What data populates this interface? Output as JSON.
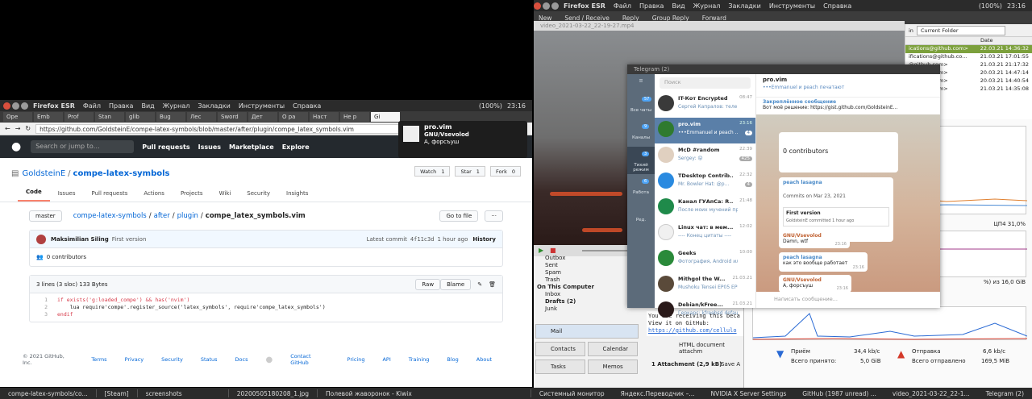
{
  "top_right_panel": {
    "app": "Firefox ESR",
    "menus": [
      "Файл",
      "Правка",
      "Вид",
      "Журнал",
      "Закладки",
      "Инструменты",
      "Справка"
    ],
    "tray_text": "(100%)",
    "time": "23:16"
  },
  "tb_toolbar": {
    "new": "New",
    "send_receive": "Send / Receive",
    "reply": "Reply",
    "group_reply": "Group Reply",
    "forward": "Forward"
  },
  "left_panel": {
    "app": "Firefox ESR",
    "menus": [
      "Файл",
      "Правка",
      "Вид",
      "Журнал",
      "Закладки",
      "Инструменты",
      "Справка"
    ],
    "battery": "(100%)",
    "time": "23:16",
    "tabs": [
      "Ope",
      "Emb",
      "Prof",
      "Stan",
      "glib",
      "Bug",
      "Лес",
      "Sword",
      "Дет",
      "O pa",
      "Hacт",
      "He p",
      "Gi"
    ],
    "url": "https://github.com/GoldsteinE/compe-latex-symbols/blob/master/after/plugin/compe_latex_symbols.vim"
  },
  "github": {
    "search_placeholder": "Search or jump to…",
    "nav": [
      "Pull requests",
      "Issues",
      "Marketplace",
      "Explore"
    ],
    "owner": "GoldsteinE",
    "repo": "compe-latex-symbols",
    "watch": "Watch",
    "watch_count": "1",
    "star": "Star",
    "star_count": "1",
    "fork": "Fork",
    "fork_count": "0",
    "tabs": [
      "Code",
      "Issues",
      "Pull requests",
      "Actions",
      "Projects",
      "Wiki",
      "Security",
      "Insights"
    ],
    "branch": "master",
    "path": [
      "compe-latex-symbols",
      "after",
      "plugin"
    ],
    "file": "compe_latex_symbols.vim",
    "go_to_file": "Go to file",
    "more": "···",
    "author": "Maksimilian Siling",
    "commit_msg": "First version",
    "latest_commit": "Latest commit",
    "commit_hash": "4f11c3d",
    "commit_time": "1 hour ago",
    "history": "History",
    "contributors": "0 contributors",
    "file_info": "3 lines (3 sloc)   133 Bytes",
    "raw": "Raw",
    "blame": "Blame",
    "code": [
      "if exists('g:loaded_compe') && has('nvim')",
      "    lua require'compe'.register_source('latex_symbols', require'compe_latex_symbols')",
      "endif"
    ],
    "footer": [
      "© 2021 GitHub, Inc.",
      "Terms",
      "Privacy",
      "Security",
      "Status",
      "Docs",
      "Contact GitHub",
      "Pricing",
      "API",
      "Training",
      "Blog",
      "About"
    ]
  },
  "notification": {
    "title": "pro.vim",
    "subtitle": "GNU/Vsevolod",
    "body": "А, форсъуш"
  },
  "video": {
    "title": "video_2021-03-22_22-19-27.mp4"
  },
  "mail_list": {
    "search_scope": "in",
    "folder": "Current Folder",
    "date_header": "Date",
    "rows": [
      {
        "from": "ications@github.com>",
        "date": "22.03.21 14:36:32"
      },
      {
        "from": "ifications@github.co...",
        "date": "21.03.21 17:01:55"
      },
      {
        "from": "@github.com>",
        "date": "21.03.21 21:17:32"
      },
      {
        "from": "@github.com>",
        "date": "20.03.21 14:47:14"
      },
      {
        "from": "@github.com>",
        "date": "20.03.21 14:40:54"
      },
      {
        "from": "@github.com>",
        "date": "21.03.21 14:35:08"
      }
    ]
  },
  "telegram": {
    "title": "Telegram (2)",
    "search": "Поиск",
    "folders": [
      {
        "label": "Все чаты",
        "badge": "57"
      },
      {
        "label": "Каналы",
        "badge": "9"
      },
      {
        "label": "Тихий режим",
        "badge": "3"
      },
      {
        "label": "Работа",
        "badge": "6"
      },
      {
        "label": "Ред.",
        "badge": ""
      }
    ],
    "chats": [
      {
        "name": "IT-Кот Encrypted",
        "preview": "Сергей Капралов: теле...",
        "time": "08:47",
        "count": ""
      },
      {
        "name": "pro.vim",
        "preview": "•••Emmanuel и peach ...",
        "time": "23:16",
        "count": "4"
      },
      {
        "name": "McD #random",
        "preview": "Sergey: 😝",
        "time": "22:39",
        "count": "425"
      },
      {
        "name": "TDesktop Contrib...",
        "preview": "Mr. Bowler Hat: @p...",
        "time": "22:32",
        "count": "4"
      },
      {
        "name": "Канал ГУАпСа: R...",
        "preview": "После моих мучений при...",
        "time": "21:48",
        "count": ""
      },
      {
        "name": "Linux чат: в мем...",
        "preview": "---- Конец цитаты ----",
        "time": "12:02",
        "count": ""
      },
      {
        "name": "Geeks",
        "preview": "Фотография, Android или l...",
        "time": "10:00",
        "count": ""
      },
      {
        "name": "Mithgol the W...",
        "preview": "Mushoku Tensei EP05 EP06...",
        "time": "21.03.21",
        "count": ""
      },
      {
        "name": "Debian/kFree...",
        "preview": "Геркарс: kfreebsd default...",
        "time": "21.03.21",
        "count": ""
      }
    ],
    "conv_title": "pro.vim",
    "conv_status": "•••Emmanuel и peach печатают",
    "pinned_label": "Закреплённое сообщение",
    "pinned_text": "Вот моё решение: https://gist.github.com/GoldsteinE...",
    "msg_contrib": "0 contributors",
    "msg_peach": "peach lasagna",
    "msg_commit": "Commits on Mar 23, 2021",
    "msg_first": "First version",
    "msg_commit_by": "GoldsteinE committed 1 hour ago",
    "msg1_author": "GNU/Vsevolod",
    "msg1_text": "Damn, wtf",
    "msg1_time": "23:16",
    "msg2_author": "peach lasagna",
    "msg2_text": "как это вообще работает",
    "msg2_time": "23:16",
    "msg3_author": "GNU/Vsevolod",
    "msg3_text": "А, форсъуш",
    "msg3_time": "23:16",
    "input_placeholder": "Написать сообщение..."
  },
  "thunderbird": {
    "folders": [
      "Outbox",
      "Sent",
      "Spam",
      "Trash",
      "On This Computer",
      "Inbox",
      "Drafts (2)",
      "Junk"
    ],
    "nav": [
      "Mail",
      "Contacts",
      "Calendar",
      "Tasks",
      "Memos"
    ],
    "preview_lines": [
      "You are receiving this beca",
      "View it on GitHub:",
      "https://github.com/cellulo"
    ],
    "attach_label": "HTML document attachm",
    "attachment": "1 Attachment (2,9 kB)",
    "save_all": "Save A"
  },
  "sysmon": {
    "cpu_label": "ЦП4 31,0%",
    "mem_label": "%) из 16,0 GiB",
    "net_recv_label": "Приём",
    "net_recv": "34,4 kb/c",
    "net_recv_total_label": "Всего принято:",
    "net_recv_total": "5,0 GiB",
    "net_send_label": "Отправка",
    "net_send": "6,6 kb/c",
    "net_send_total_label": "Всего отправлено",
    "net_send_total": "169,5 MiB"
  },
  "taskbar_left": [
    "compe-latex-symbols/co...",
    "[Steam]",
    "screenshots",
    "20200505180208_1.jpg",
    "Полевой жаворонок - Kiwix"
  ],
  "taskbar_right": [
    "Системный монитор",
    "Яндекс.Переводчик –...",
    "NVIDIA X Server Settings",
    "GitHub (1987 unread) ...",
    "video_2021-03-22_22-1...",
    "Telegram (2)"
  ]
}
